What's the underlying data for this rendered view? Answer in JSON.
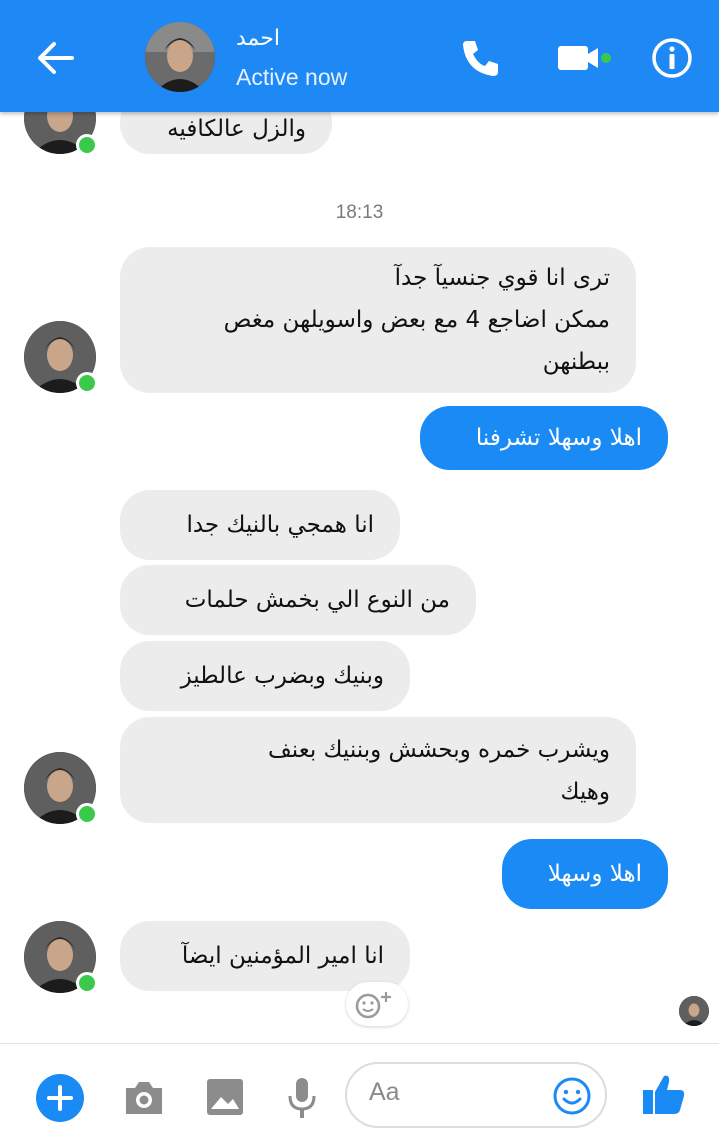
{
  "header": {
    "contact_name": "احمد",
    "status": "Active now",
    "colors": {
      "bar": "#1e88f5",
      "active": "#3bc94b"
    },
    "icons": [
      "back-arrow-icon",
      "phone-icon",
      "video-camera-icon",
      "info-icon"
    ]
  },
  "messages": {
    "top_partial": "والزل عالكافيه",
    "timestamp": "18:13",
    "m1": "ترى انا قوي جنسيآ جدآ\nممكن اضاجع 4 مع بعض واسويلهن مغص\nببطنهن",
    "m2": "اهلا وسهلا تشرفنا",
    "m3": "انا همجي بالنيك جدا",
    "m4": "من النوع الي بخمش حلمات",
    "m5": "وبنيك وبضرب عالطيز",
    "m6": "ويشرب خمره وبحشش وبننيك بعنف\nوهيك",
    "m7": "اهلا وسهلا",
    "m8": "انا امير المؤمنين ايضآ"
  },
  "composer": {
    "placeholder": "Aa",
    "icons": [
      "add-icon",
      "camera-icon",
      "image-icon",
      "microphone-icon",
      "emoji-icon",
      "thumbs-up-icon"
    ],
    "accent": "#1a8af5"
  }
}
